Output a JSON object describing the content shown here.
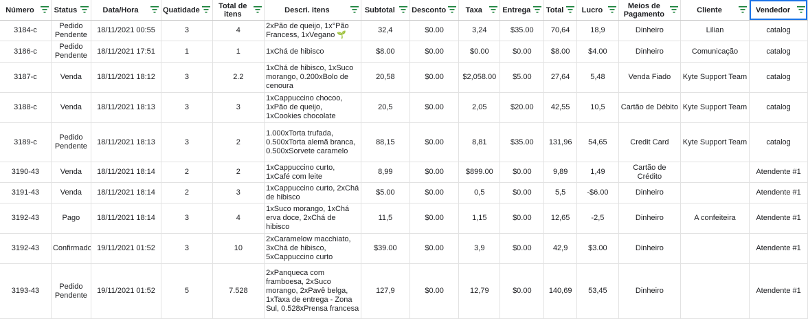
{
  "columns": [
    {
      "key": "numero",
      "label": "Número"
    },
    {
      "key": "status",
      "label": "Status"
    },
    {
      "key": "data",
      "label": "Data/Hora"
    },
    {
      "key": "quantidade",
      "label": "Quatidade"
    },
    {
      "key": "total_itens",
      "label": "Total de itens"
    },
    {
      "key": "descricao",
      "label": "Descri. itens"
    },
    {
      "key": "subtotal",
      "label": "Subtotal"
    },
    {
      "key": "desconto",
      "label": "Desconto"
    },
    {
      "key": "taxa",
      "label": "Taxa"
    },
    {
      "key": "entrega",
      "label": "Entrega"
    },
    {
      "key": "total",
      "label": "Total"
    },
    {
      "key": "lucro",
      "label": "Lucro"
    },
    {
      "key": "pagamento",
      "label": "Meios de Pagamento"
    },
    {
      "key": "cliente",
      "label": "Cliente"
    },
    {
      "key": "vendedor",
      "label": "Vendedor"
    }
  ],
  "filter_icon": "filter-icon",
  "accent_color": "#188038",
  "selection_color": "#1a73e8",
  "rows": [
    {
      "numero": "3184-c",
      "status": "Pedido Pendente",
      "data": "18/11/2021 00:55",
      "quantidade": "3",
      "total_itens": "4",
      "descricao": "2xPão de queijo, 1x°Pão Francess, 1xVegano 🌱",
      "subtotal": "32,4",
      "desconto": "$0.00",
      "taxa": "3,24",
      "entrega": "$35.00",
      "total": "70,64",
      "lucro": "18,9",
      "pagamento": "Dinheiro",
      "cliente": "Lilian",
      "vendedor": "catalog"
    },
    {
      "numero": "3186-c",
      "status": "Pedido Pendente",
      "data": "18/11/2021 17:51",
      "quantidade": "1",
      "total_itens": "1",
      "descricao": "1xChá de hibisco",
      "subtotal": "$8.00",
      "desconto": "$0.00",
      "taxa": "$0.00",
      "entrega": "$0.00",
      "total": "$8.00",
      "lucro": "$4.00",
      "pagamento": "Dinheiro",
      "cliente": "Comunicação",
      "vendedor": "catalog"
    },
    {
      "numero": "3187-c",
      "status": "Venda",
      "data": "18/11/2021 18:12",
      "quantidade": "3",
      "total_itens": "2.2",
      "descricao": "1xChá de hibisco, 1xSuco morango, 0.200xBolo de cenoura",
      "subtotal": "20,58",
      "desconto": "$0.00",
      "taxa": "$2,058.00",
      "entrega": "$5.00",
      "total": "27,64",
      "lucro": "5,48",
      "pagamento": "Venda Fiado",
      "cliente": "Kyte Support Team",
      "vendedor": "catalog"
    },
    {
      "numero": "3188-c",
      "status": "Venda",
      "data": "18/11/2021 18:13",
      "quantidade": "3",
      "total_itens": "3",
      "descricao": "1xCappuccino chocoo, 1xPão de queijo, 1xCookies chocolate",
      "subtotal": "20,5",
      "desconto": "$0.00",
      "taxa": "2,05",
      "entrega": "$20.00",
      "total": "42,55",
      "lucro": "10,5",
      "pagamento": "Cartão de Débito",
      "cliente": "Kyte Support Team",
      "vendedor": "catalog"
    },
    {
      "numero": "3189-c",
      "status": "Pedido Pendente",
      "data": "18/11/2021 18:13",
      "quantidade": "3",
      "total_itens": "2",
      "descricao": "1.000xTorta trufada, 0.500xTorta alemã branca, 0.500xSorvete caramelo",
      "subtotal": "88,15",
      "desconto": "$0.00",
      "taxa": "8,81",
      "entrega": "$35.00",
      "total": "131,96",
      "lucro": "54,65",
      "pagamento": "Credit Card",
      "cliente": "Kyte Support Team",
      "vendedor": "catalog"
    },
    {
      "numero": "3190-43",
      "status": "Venda",
      "data": "18/11/2021 18:14",
      "quantidade": "2",
      "total_itens": "2",
      "descricao": "1xCappuccino curto, 1xCafé com leite",
      "subtotal": "8,99",
      "desconto": "$0.00",
      "taxa": "$899.00",
      "entrega": "$0.00",
      "total": "9,89",
      "lucro": "1,49",
      "pagamento": "Cartão de Crédito",
      "cliente": "",
      "vendedor": "Atendente #1"
    },
    {
      "numero": "3191-43",
      "status": "Venda",
      "data": "18/11/2021 18:14",
      "quantidade": "2",
      "total_itens": "3",
      "descricao": "1xCappuccino curto, 2xChá de hibisco",
      "subtotal": "$5.00",
      "desconto": "$0.00",
      "taxa": "0,5",
      "entrega": "$0.00",
      "total": "5,5",
      "lucro": "-$6.00",
      "pagamento": "Dinheiro",
      "cliente": "",
      "vendedor": "Atendente #1"
    },
    {
      "numero": "3192-43",
      "status": "Pago",
      "data": "18/11/2021 18:14",
      "quantidade": "3",
      "total_itens": "4",
      "descricao": "1xSuco morango, 1xChá erva doce, 2xChá de hibisco",
      "subtotal": "11,5",
      "desconto": "$0.00",
      "taxa": "1,15",
      "entrega": "$0.00",
      "total": "12,65",
      "lucro": "-2,5",
      "pagamento": "Dinheiro",
      "cliente": "A confeiteira",
      "vendedor": "Atendente #1"
    },
    {
      "numero": "3192-43",
      "status": "Confirmado",
      "data": "19/11/2021 01:52",
      "quantidade": "3",
      "total_itens": "10",
      "descricao": "2xCaramelow macchiato, 3xChá de hibisco, 5xCappuccino curto",
      "subtotal": "$39.00",
      "desconto": "$0.00",
      "taxa": "3,9",
      "entrega": "$0.00",
      "total": "42,9",
      "lucro": "$3.00",
      "pagamento": "Dinheiro",
      "cliente": "",
      "vendedor": "Atendente #1"
    },
    {
      "numero": "3193-43",
      "status": "Pedido Pendente",
      "data": "19/11/2021 01:52",
      "quantidade": "5",
      "total_itens": "7.528",
      "descricao": "2xPanqueca com framboesa, 2xSuco morango, 2xPavê belga, 1xTaxa de entrega - Zona Sul, 0.528xPrensa francesa",
      "subtotal": "127,9",
      "desconto": "$0.00",
      "taxa": "12,79",
      "entrega": "$0.00",
      "total": "140,69",
      "lucro": "53,45",
      "pagamento": "Dinheiro",
      "cliente": "",
      "vendedor": "Atendente #1"
    }
  ]
}
